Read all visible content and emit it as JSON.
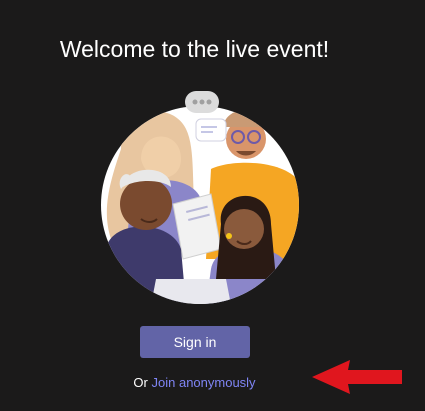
{
  "page": {
    "title": "Welcome to the live event!"
  },
  "actions": {
    "signin_label": "Sign in",
    "join_prefix": "Or",
    "join_link_label": "Join anonymously"
  },
  "colors": {
    "background": "#1b1a1a",
    "accent": "#6264a7",
    "link": "#7f85f5",
    "annotation_arrow": "#e0161e"
  },
  "icons": {
    "illustration": "people-group-illustration",
    "annotation": "red-arrow-left-icon"
  }
}
